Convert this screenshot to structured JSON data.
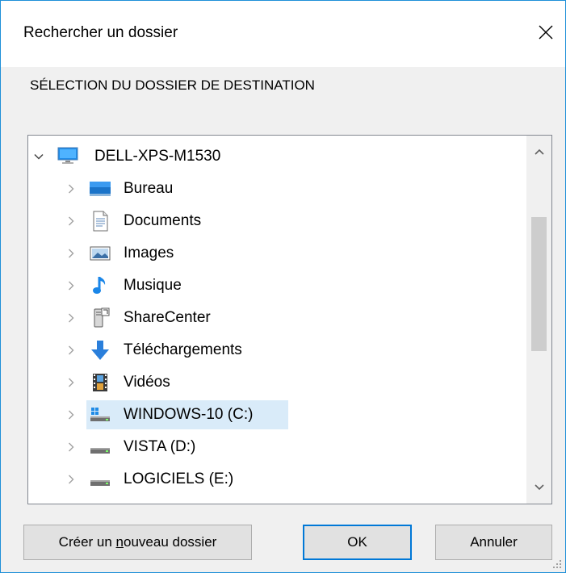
{
  "dialog": {
    "title": "Rechercher un dossier",
    "instruction": "SÉLECTION DU DOSSIER DE DESTINATION"
  },
  "tree": {
    "root": {
      "label": "DELL-XPS-M1530",
      "icon": "computer-icon",
      "expanded": true
    },
    "items": [
      {
        "label": "Bureau",
        "icon": "desktop-folder-icon"
      },
      {
        "label": "Documents",
        "icon": "documents-icon"
      },
      {
        "label": "Images",
        "icon": "pictures-icon"
      },
      {
        "label": "Musique",
        "icon": "music-icon"
      },
      {
        "label": "ShareCenter",
        "icon": "network-share-icon"
      },
      {
        "label": "Téléchargements",
        "icon": "downloads-icon"
      },
      {
        "label": "Vidéos",
        "icon": "videos-icon"
      },
      {
        "label": "WINDOWS-10 (C:)",
        "icon": "system-drive-icon",
        "selected": true
      },
      {
        "label": "VISTA (D:)",
        "icon": "drive-icon"
      },
      {
        "label": "LOGICIELS (E:)",
        "icon": "drive-icon"
      }
    ]
  },
  "buttons": {
    "new_folder_pre": "Créer un ",
    "new_folder_key": "n",
    "new_folder_post": "ouveau dossier",
    "ok": "OK",
    "cancel": "Annuler"
  },
  "colors": {
    "accent": "#0078d7",
    "window_border": "#1e90d8",
    "selection": "#d9ebf9",
    "dialog_bg": "#f0f0f0"
  }
}
